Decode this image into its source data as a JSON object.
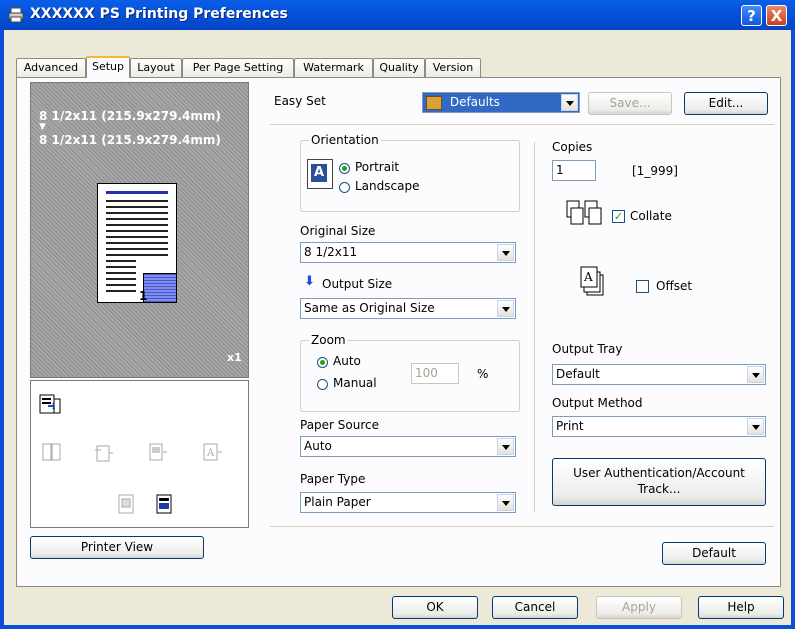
{
  "window": {
    "title": "XXXXXX PS Printing Preferences",
    "help_label": "?",
    "close_label": "X"
  },
  "tabs": [
    {
      "label": "Advanced"
    },
    {
      "label": "Setup"
    },
    {
      "label": "Layout"
    },
    {
      "label": "Per Page Setting"
    },
    {
      "label": "Watermark"
    },
    {
      "label": "Quality"
    },
    {
      "label": "Version"
    }
  ],
  "preview": {
    "from_size": "8 1/2x11 (215.9x279.4mm)",
    "arrow": "▼",
    "to_size": "8 1/2x11 (215.9x279.4mm)",
    "copies_mark": "x1",
    "page_number": "1"
  },
  "printer_view_label": "Printer View",
  "easy_set": {
    "label": "Easy Set",
    "value": "Defaults",
    "save_label": "Save...",
    "edit_label": "Edit..."
  },
  "orientation": {
    "group_label": "Orientation",
    "portrait": "Portrait",
    "landscape": "Landscape",
    "selected": "Portrait",
    "icon_letter": "A"
  },
  "original_size": {
    "label": "Original Size",
    "value": "8 1/2x11"
  },
  "output_size": {
    "label": "Output Size",
    "value": "Same as Original Size"
  },
  "zoom": {
    "group_label": "Zoom",
    "auto": "Auto",
    "manual": "Manual",
    "selected": "Auto",
    "value": "100",
    "unit": "%"
  },
  "paper_source": {
    "label": "Paper Source",
    "value": "Auto"
  },
  "paper_type": {
    "label": "Paper Type",
    "value": "Plain Paper"
  },
  "copies": {
    "label": "Copies",
    "value": "1",
    "range": "[1_999]"
  },
  "collate": {
    "label": "Collate",
    "checked": true
  },
  "offset": {
    "label": "Offset",
    "checked": false
  },
  "output_tray": {
    "label": "Output Tray",
    "value": "Default"
  },
  "output_method": {
    "label": "Output Method",
    "value": "Print"
  },
  "user_auth": {
    "line1": "User Authentication/Account",
    "line2": "Track..."
  },
  "default_label": "Default",
  "footer": {
    "ok": "OK",
    "cancel": "Cancel",
    "apply": "Apply",
    "help": "Help"
  }
}
